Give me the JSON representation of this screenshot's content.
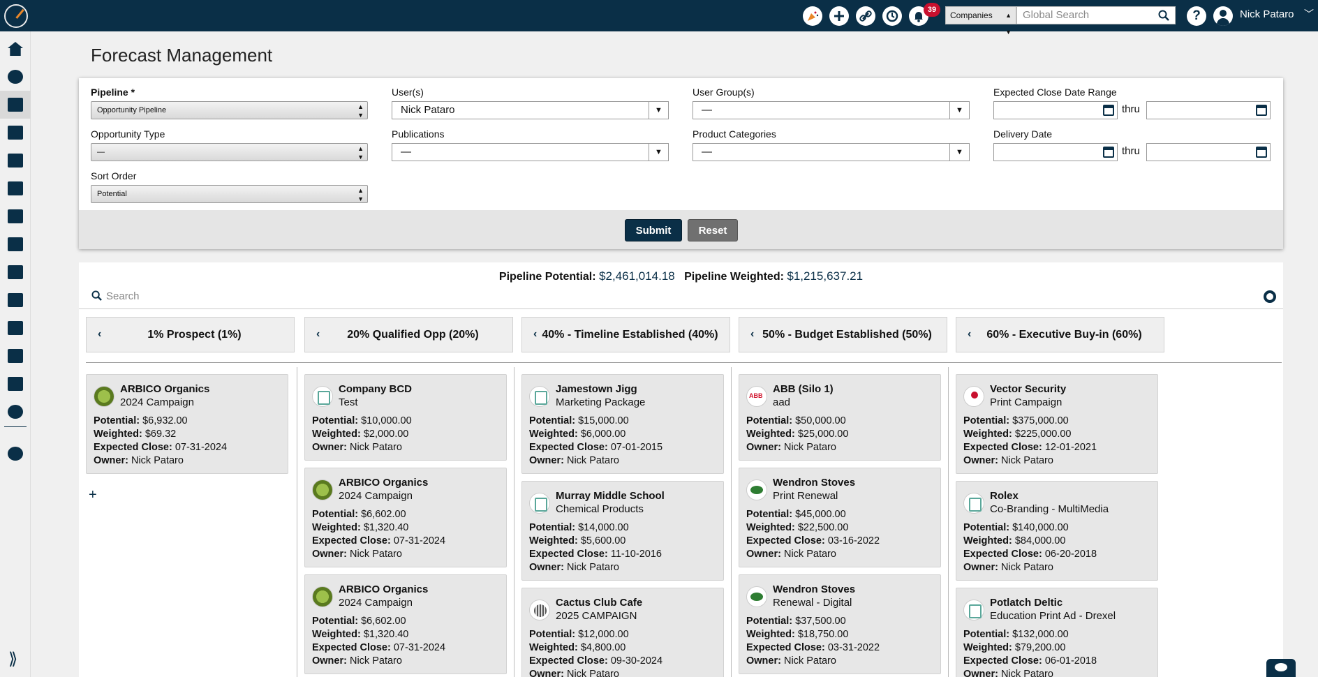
{
  "app": {
    "title": "Forecast Management"
  },
  "topbar": {
    "notification_count": "39",
    "search_type": "Companies",
    "search_placeholder": "Global Search",
    "user_name": "Nick Pataro"
  },
  "filters": {
    "pipeline": {
      "label": "Pipeline *",
      "value": "Opportunity Pipeline"
    },
    "users": {
      "label": "User(s)",
      "value": "Nick Pataro"
    },
    "user_groups": {
      "label": "User Group(s)",
      "value": "—"
    },
    "close_date_range": {
      "label": "Expected Close Date Range",
      "thru": "thru"
    },
    "opportunity_type": {
      "label": "Opportunity Type",
      "value": "—"
    },
    "publications": {
      "label": "Publications",
      "value": "—"
    },
    "product_categories": {
      "label": "Product Categories",
      "value": "—"
    },
    "delivery_date": {
      "label": "Delivery Date",
      "thru": "thru"
    },
    "sort_order": {
      "label": "Sort Order",
      "value": "Potential"
    },
    "submit_label": "Submit",
    "reset_label": "Reset"
  },
  "board": {
    "potential_label": "Pipeline Potential:",
    "potential_value": "$2,461,014.18",
    "weighted_label": "Pipeline Weighted:",
    "weighted_value": "$1,215,637.21",
    "search_placeholder": "Search",
    "add_symbol": "+",
    "field_labels": {
      "potential": "Potential:",
      "weighted": "Weighted:",
      "expected_close": "Expected Close:",
      "owner": "Owner:"
    },
    "stages": [
      {
        "title": "1% Prospect (1%)",
        "cards": [
          {
            "company": "ARBICO Organics",
            "campaign": "2024 Campaign",
            "potential": "$6,932.00",
            "weighted": "$69.32",
            "expected_close": "07-31-2024",
            "owner": "Nick Pataro",
            "logo": "org"
          }
        ]
      },
      {
        "title": "20% Qualified Opp (20%)",
        "cards": [
          {
            "company": "Company BCD",
            "campaign": "Test",
            "potential": "$10,000.00",
            "weighted": "$2,000.00",
            "expected_close": "",
            "owner": "Nick Pataro",
            "logo": "bld"
          },
          {
            "company": "ARBICO Organics",
            "campaign": "2024 Campaign",
            "potential": "$6,602.00",
            "weighted": "$1,320.40",
            "expected_close": "07-31-2024",
            "owner": "Nick Pataro",
            "logo": "org"
          },
          {
            "company": "ARBICO Organics",
            "campaign": "2024 Campaign",
            "potential": "$6,602.00",
            "weighted": "$1,320.40",
            "expected_close": "07-31-2024",
            "owner": "Nick Pataro",
            "logo": "org"
          }
        ]
      },
      {
        "title": "40% - Timeline Established (40%)",
        "cards": [
          {
            "company": "Jamestown Jigg",
            "campaign": "Marketing Package",
            "potential": "$15,000.00",
            "weighted": "$6,000.00",
            "expected_close": "07-01-2015",
            "owner": "Nick Pataro",
            "logo": "bld"
          },
          {
            "company": "Murray Middle School",
            "campaign": "Chemical Products",
            "potential": "$14,000.00",
            "weighted": "$5,600.00",
            "expected_close": "11-10-2016",
            "owner": "Nick Pataro",
            "logo": "bld"
          },
          {
            "company": "Cactus Club Cafe",
            "campaign": "2025 CAMPAIGN",
            "potential": "$12,000.00",
            "weighted": "$4,800.00",
            "expected_close": "09-30-2024",
            "owner": "Nick Pataro",
            "logo": "cac"
          }
        ]
      },
      {
        "title": "50% - Budget Established (50%)",
        "cards": [
          {
            "company": "ABB (Silo 1)",
            "campaign": "aad",
            "potential": "$50,000.00",
            "weighted": "$25,000.00",
            "expected_close": "",
            "owner": "Nick Pataro",
            "logo": "abb"
          },
          {
            "company": "Wendron Stoves",
            "campaign": "Print Renewal",
            "potential": "$45,000.00",
            "weighted": "$22,500.00",
            "expected_close": "03-16-2022",
            "owner": "Nick Pataro",
            "logo": "wen"
          },
          {
            "company": "Wendron Stoves",
            "campaign": "Renewal - Digital",
            "potential": "$37,500.00",
            "weighted": "$18,750.00",
            "expected_close": "03-31-2022",
            "owner": "Nick Pataro",
            "logo": "wen"
          }
        ]
      },
      {
        "title": "60% - Executive Buy-in (60%)",
        "cards": [
          {
            "company": "Vector Security",
            "campaign": "Print Campaign",
            "potential": "$375,000.00",
            "weighted": "$225,000.00",
            "expected_close": "12-01-2021",
            "owner": "Nick Pataro",
            "logo": "vec"
          },
          {
            "company": "Rolex",
            "campaign": "Co-Branding - MultiMedia",
            "potential": "$140,000.00",
            "weighted": "$84,000.00",
            "expected_close": "06-20-2018",
            "owner": "Nick Pataro",
            "logo": "bld"
          },
          {
            "company": "Potlatch Deltic",
            "campaign": "Education Print Ad - Drexel",
            "potential": "$132,000.00",
            "weighted": "$79,200.00",
            "expected_close": "06-01-2018",
            "owner": "Nick Pataro",
            "logo": "bld"
          }
        ]
      }
    ]
  },
  "sidebar": {
    "items": [
      "home-icon",
      "contacts-icon",
      "handshake-icon",
      "media-icon",
      "document-icon",
      "billing-icon",
      "tasks-icon",
      "cart-icon",
      "calendar-icon",
      "mailbox-icon",
      "delivery-icon",
      "tax-form-icon",
      "mail-icon",
      "analytics-icon",
      "settings-icon"
    ],
    "active_index": 2
  },
  "colors": {
    "brand": "#0a2f47",
    "badge": "#c8102e",
    "card_bg": "#e7e7e7"
  }
}
